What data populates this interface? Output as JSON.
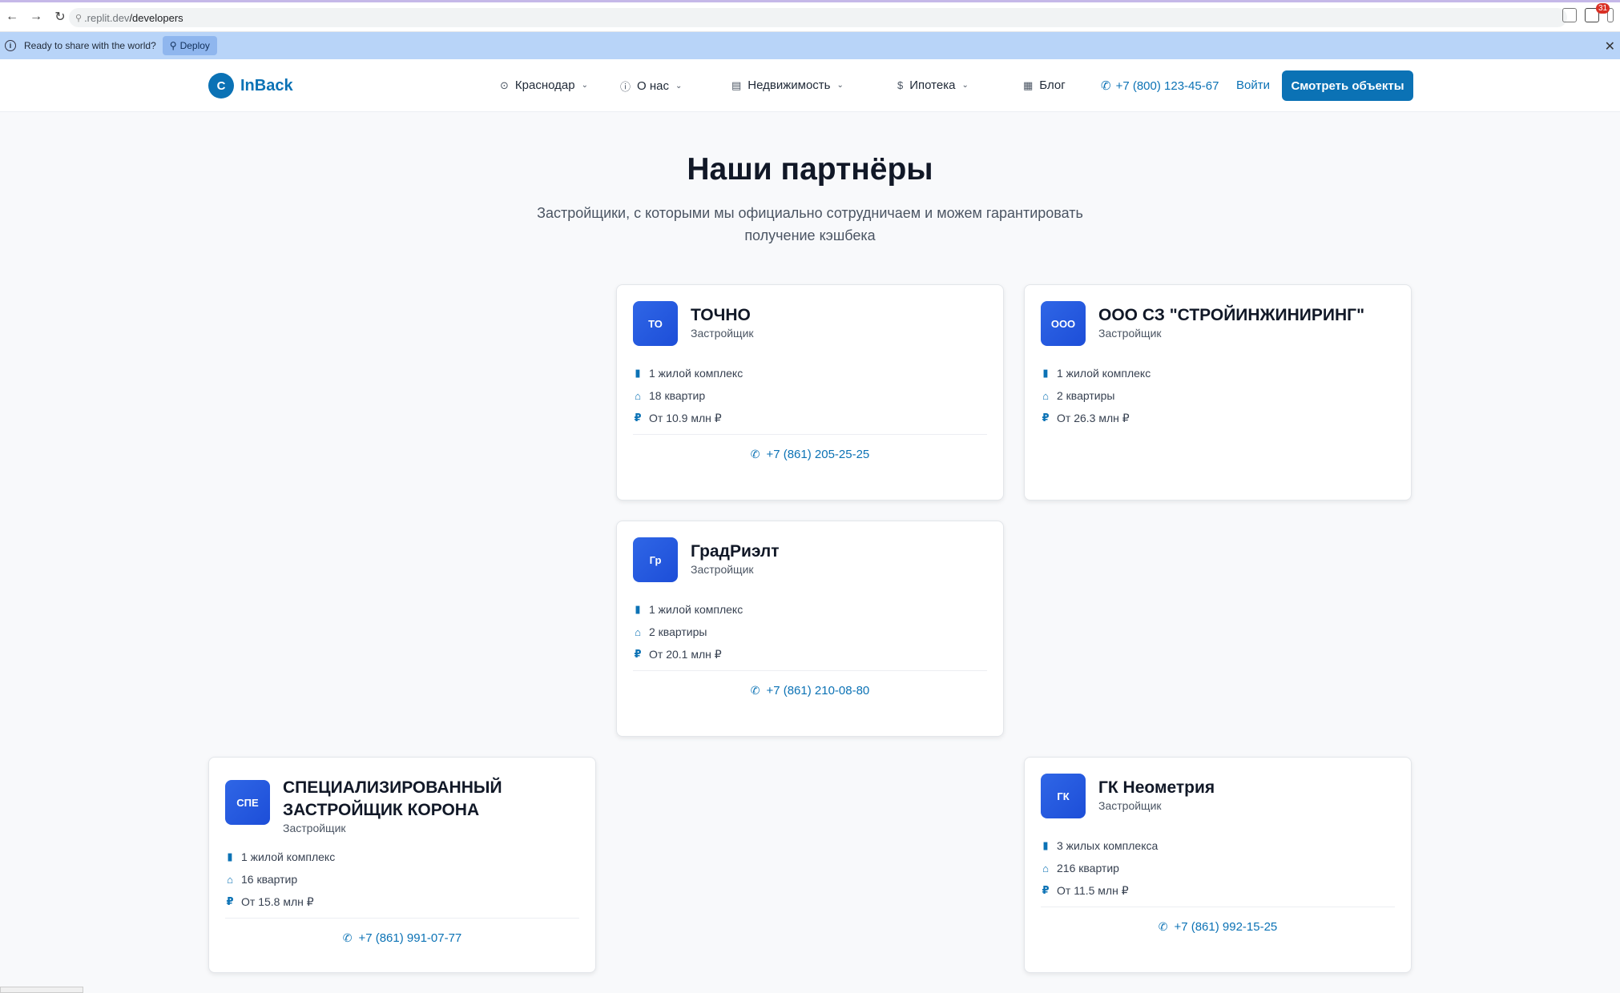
{
  "browser": {
    "url_host": ".replit.dev",
    "url_path": "/developers",
    "ext_badge": "31"
  },
  "banner": {
    "message": "Ready to share with the world?",
    "deploy_label": "Deploy"
  },
  "header": {
    "logo_letter": "C",
    "logo_text": "InBack",
    "nav": [
      {
        "label": "Краснодар",
        "icon": "map-pin-icon"
      },
      {
        "label": "О нас",
        "icon": "info-icon"
      },
      {
        "label": "Недвижимость",
        "icon": "building-icon"
      },
      {
        "label": "Ипотека",
        "icon": "coin-icon"
      },
      {
        "label": "Блог",
        "icon": "newspaper-icon"
      }
    ],
    "phone": "+7 (800) 123-45-67",
    "login": "Войти",
    "cta": "Смотреть объекты"
  },
  "page": {
    "title": "Наши партнёры",
    "subtitle": "Застройщики, с которыми мы официально сотрудничаем и можем гарантировать получение кэшбека"
  },
  "cards": [
    {
      "initials": "ТО",
      "name": "ТОЧНО",
      "role": "Застройщик",
      "complexes": "1 жилой комплекс",
      "apartments": "18 квартир",
      "price": "От 10.9 млн ₽",
      "phone": "+7 (861) 205-25-25"
    },
    {
      "initials": "ООО",
      "name": "ООО СЗ \"СТРОЙИНЖИНИРИНГ\"",
      "role": "Застройщик",
      "complexes": "1 жилой комплекс",
      "apartments": "2 квартиры",
      "price": "От 26.3 млн ₽",
      "phone": ""
    },
    {
      "initials": "Гр",
      "name": "ГрадРиэлт",
      "role": "Застройщик",
      "complexes": "1 жилой комплекс",
      "apartments": "2 квартиры",
      "price": "От 20.1 млн ₽",
      "phone": "+7 (861) 210-08-80"
    },
    {
      "initials": "СПЕ",
      "name": "СПЕЦИАЛИЗИРОВАННЫЙ ЗАСТРОЙЩИК КОРОНА",
      "role": "Застройщик",
      "complexes": "1 жилой комплекс",
      "apartments": "16 квартир",
      "price": "От 15.8 млн ₽",
      "phone": "+7 (861) 991-07-77"
    },
    {
      "initials": "ГК",
      "name": "ГК Неометрия",
      "role": "Застройщик",
      "complexes": "3 жилых комплекса",
      "apartments": "216 квартир",
      "price": "От 11.5 млн ₽",
      "phone": "+7 (861) 992-15-25"
    }
  ],
  "colors": {
    "accent": "#0b72b5",
    "avatar": "#2f66e6",
    "banner": "#b8d4f8"
  }
}
